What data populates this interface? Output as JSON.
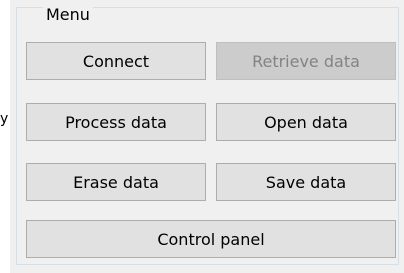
{
  "stray_glyph": "y",
  "menu": {
    "title": "Menu",
    "buttons": {
      "connect": {
        "label": "Connect",
        "enabled": true
      },
      "retrieve_data": {
        "label": "Retrieve data",
        "enabled": false
      },
      "process_data": {
        "label": "Process data",
        "enabled": true
      },
      "open_data": {
        "label": "Open data",
        "enabled": true
      },
      "erase_data": {
        "label": "Erase data",
        "enabled": true
      },
      "save_data": {
        "label": "Save data",
        "enabled": true
      },
      "control_panel": {
        "label": "Control panel",
        "enabled": true
      }
    }
  },
  "colors": {
    "panel_background": "#f0f0f0",
    "button_face": "#e1e1e1",
    "button_border": "#adadad",
    "disabled_face": "#cccccc",
    "disabled_text": "#838383",
    "group_border": "#d5dfe5"
  }
}
